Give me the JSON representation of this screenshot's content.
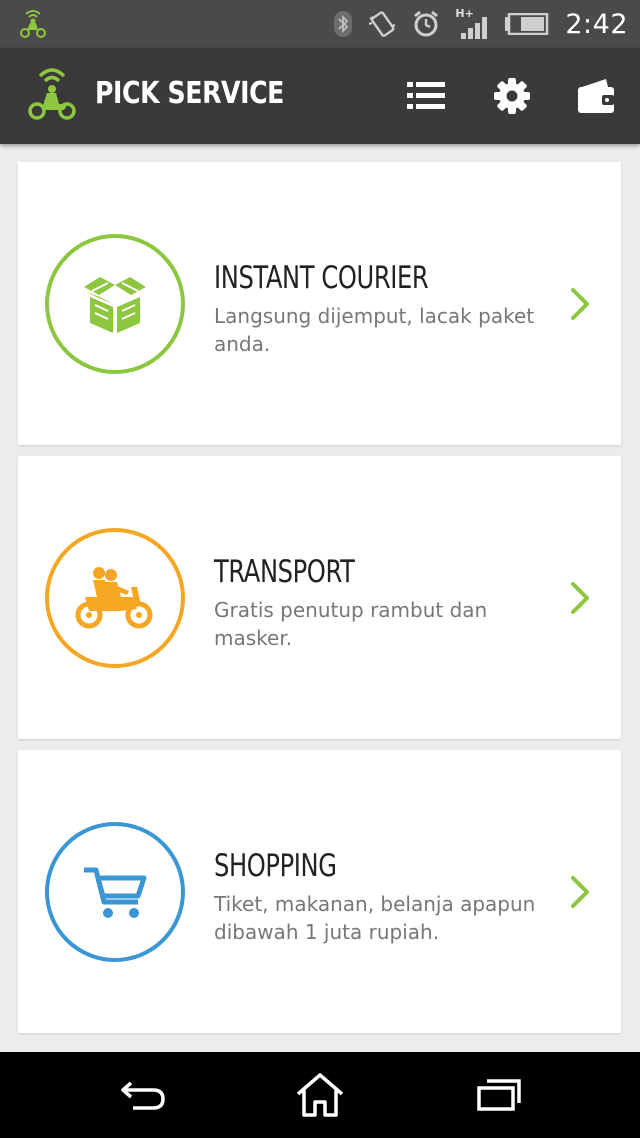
{
  "status_bar": {
    "time": "2:42",
    "network_type": "H+",
    "icons": [
      "gojek-notification-icon",
      "bluetooth-icon",
      "vibrate-icon",
      "alarm-icon",
      "signal-icon",
      "battery-icon"
    ]
  },
  "action_bar": {
    "title": "PICK SERVICE",
    "icons": [
      "gojek-logo",
      "list-icon",
      "gear-icon",
      "wallet-icon"
    ]
  },
  "services": [
    {
      "name": "INSTANT COURIER",
      "description": "Langsung dijemput, lacak paket anda.",
      "icon": "package-box-icon",
      "color": "#8dc63f"
    },
    {
      "name": "TRANSPORT",
      "description": "Gratis penutup rambut dan masker.",
      "icon": "motorbike-riders-icon",
      "color": "#f5a623"
    },
    {
      "name": "SHOPPING",
      "description": "Tiket, makanan, belanja apapun dibawah 1 juta rupiah.",
      "icon": "shopping-cart-icon",
      "color": "#3a97d4"
    }
  ],
  "theme": {
    "accent_green": "#8dc63f",
    "status_bar_bg": "#4a4a4a",
    "action_bar_bg": "#3a3a3a",
    "background": "#ececec"
  },
  "nav_bar": {
    "icons": [
      "back-icon",
      "home-icon",
      "recent-apps-icon"
    ]
  }
}
